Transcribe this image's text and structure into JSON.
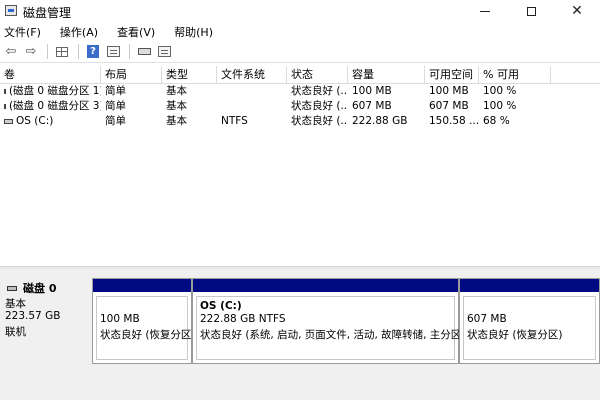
{
  "window": {
    "title": "磁盘管理"
  },
  "menu": [
    "文件(F)",
    "操作(A)",
    "查看(V)",
    "帮助(H)"
  ],
  "toolbar": [
    "back-icon",
    "forward-icon",
    "grid-icon",
    "help-icon",
    "properties-icon",
    "disk-icon",
    "list-icon"
  ],
  "table": {
    "columns": [
      "卷",
      "布局",
      "类型",
      "文件系统",
      "状态",
      "容量",
      "可用空间",
      "% 可用"
    ],
    "rows": [
      {
        "volume": "(磁盘 0 磁盘分区 1)",
        "layout": "简单",
        "type": "基本",
        "fs": "",
        "status": "状态良好 (...",
        "capacity": "100 MB",
        "free": "100 MB",
        "pct": "100 %"
      },
      {
        "volume": "(磁盘 0 磁盘分区 3)",
        "layout": "简单",
        "type": "基本",
        "fs": "",
        "status": "状态良好 (...",
        "capacity": "607 MB",
        "free": "607 MB",
        "pct": "100 %"
      },
      {
        "volume": "OS (C:)",
        "layout": "简单",
        "type": "基本",
        "fs": "NTFS",
        "status": "状态良好 (...",
        "capacity": "222.88 GB",
        "free": "150.58 ...",
        "pct": "68 %"
      }
    ]
  },
  "disk": {
    "title": "磁盘 0",
    "type": "基本",
    "size": "223.57 GB",
    "status": "联机",
    "partitions": [
      {
        "name": "",
        "size": "100 MB",
        "status": "状态良好 (恢复分区)"
      },
      {
        "name": "OS  (C:)",
        "size": "222.88 GB NTFS",
        "status": "状态良好 (系统, 启动, 页面文件, 活动, 故障转储, 主分区)"
      },
      {
        "name": "",
        "size": "607 MB",
        "status": "状态良好 (恢复分区)"
      }
    ]
  }
}
